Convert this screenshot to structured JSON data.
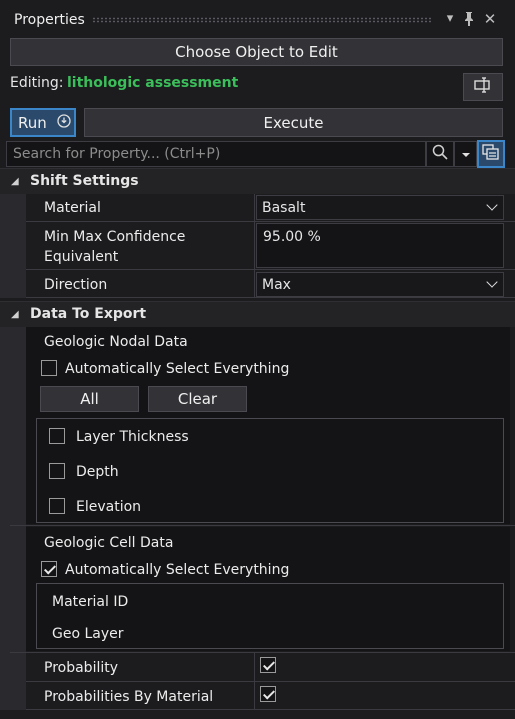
{
  "panel": {
    "title": "Properties"
  },
  "window_controls": {
    "dropdown": "▾",
    "pin": "⊥",
    "close": "✕"
  },
  "top": {
    "choose_label": "Choose Object to Edit",
    "editing_label": "Editing:",
    "editing_value": "lithologic assessment",
    "run_label": "Run",
    "execute_label": "Execute"
  },
  "search": {
    "placeholder": "Search for Property... (Ctrl+P)"
  },
  "shift_settings": {
    "header": "Shift Settings",
    "material_label": "Material",
    "material_value": "Basalt",
    "confidence_label_1": "Min Max Confidence",
    "confidence_label_2": "Equivalent",
    "confidence_value": "95.00 %",
    "direction_label": "Direction",
    "direction_value": "Max"
  },
  "data_to_export": {
    "header": "Data To Export",
    "nodal": {
      "title": "Geologic Nodal Data",
      "auto_select_label": "Automatically Select Everything",
      "auto_select_checked": false,
      "all_label": "All",
      "clear_label": "Clear",
      "items": [
        {
          "label": "Layer Thickness",
          "checked": false
        },
        {
          "label": "Depth",
          "checked": false
        },
        {
          "label": "Elevation",
          "checked": false
        }
      ]
    },
    "cell": {
      "title": "Geologic Cell Data",
      "auto_select_label": "Automatically Select Everything",
      "auto_select_checked": true,
      "items": [
        "Material ID",
        "Geo Layer"
      ]
    },
    "probability_label": "Probability",
    "probability_checked": true,
    "probabilities_by_material_label": "Probabilities By Material",
    "probabilities_by_material_checked": true
  },
  "colors": {
    "accent_green": "#3bbf5a",
    "run_blue": "#3a86c8"
  }
}
